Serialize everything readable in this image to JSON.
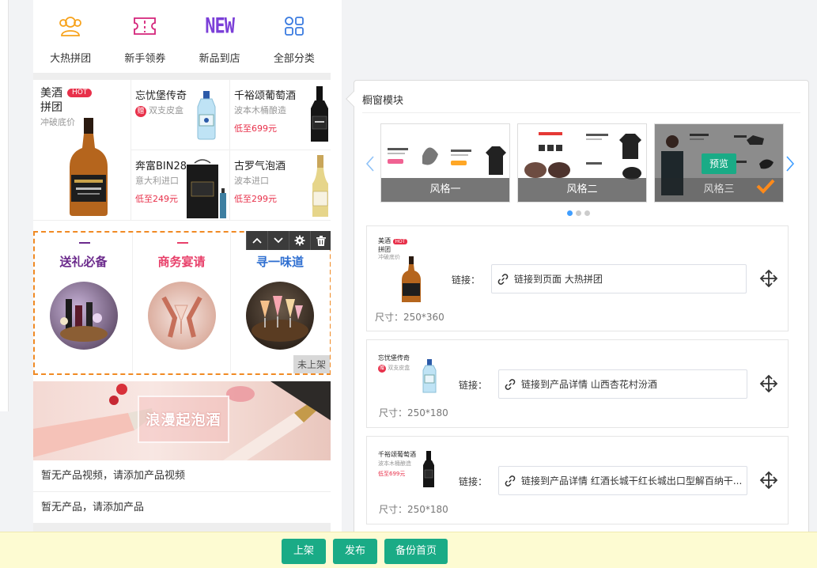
{
  "nav": {
    "items": [
      {
        "label": "大热拼团",
        "icon": "group-buy-icon"
      },
      {
        "label": "新手领券",
        "icon": "coupon-icon"
      },
      {
        "label": "新品到店",
        "icon": "new-icon",
        "icon_text": "NEW"
      },
      {
        "label": "全部分类",
        "icon": "category-grid-icon"
      }
    ]
  },
  "products": {
    "featured": {
      "title_line1": "美酒",
      "title_line2": "拼团",
      "badge": "HOT",
      "subtitle": "冲破底价"
    },
    "items": [
      {
        "title": "忘忧堡传奇",
        "badge": "赠",
        "subtitle": "双支皮盒",
        "price": ""
      },
      {
        "title": "千裕颂葡萄酒",
        "subtitle": "波本木桶酿造",
        "price": "低至699元"
      },
      {
        "title": "奔富BIN28",
        "subtitle": "意大利进口",
        "price": "低至249元"
      },
      {
        "title": "古罗气泡酒",
        "subtitle": "波本进口",
        "price": "低至299元"
      }
    ]
  },
  "module": {
    "columns": [
      {
        "title": "送礼必备",
        "color": "#6b2a8c"
      },
      {
        "title": "商务宴请",
        "color": "#e8406a"
      },
      {
        "title": "寻一味道",
        "color": "#2f6fd1"
      }
    ],
    "status_tag": "未上架"
  },
  "banner": {
    "text": "浪漫起泡酒"
  },
  "messages": {
    "no_video": "暂无产品视频，请添加产品视频",
    "no_product": "暂无产品，请添加产品"
  },
  "panel": {
    "title": "橱窗模块",
    "styles": [
      {
        "label": "风格一"
      },
      {
        "label": "风格二"
      },
      {
        "label": "风格三",
        "selected": true
      }
    ],
    "preview_label": "预览",
    "link_label": "链接：",
    "cards": [
      {
        "thumb_title_1": "美酒",
        "thumb_title_2": "拼团",
        "thumb_badge": "HOT",
        "thumb_sub": "冲破底价",
        "link": "链接到页面 大热拼团",
        "size": "尺寸：250*360"
      },
      {
        "thumb_title": "忘忧堡传奇",
        "thumb_badge": "赠",
        "thumb_sub": "双支皮盒",
        "link": "链接到产品详情 山西杏花村汾酒",
        "size": "尺寸：250*180"
      },
      {
        "thumb_title": "千裕颂葡萄酒",
        "thumb_sub": "波本木桶酿造",
        "thumb_price": "低至699元",
        "link": "链接到产品详情 红酒长城干红长城出口型解百纳干...",
        "size": "尺寸：250*180"
      }
    ]
  },
  "footer": {
    "publish_shelf": "上架",
    "release": "发布",
    "backup_home": "备份首页"
  },
  "colors": {
    "accent": "#1aab86",
    "selection": "#f08a24",
    "link": "#409eff",
    "price": "#e8304a"
  }
}
